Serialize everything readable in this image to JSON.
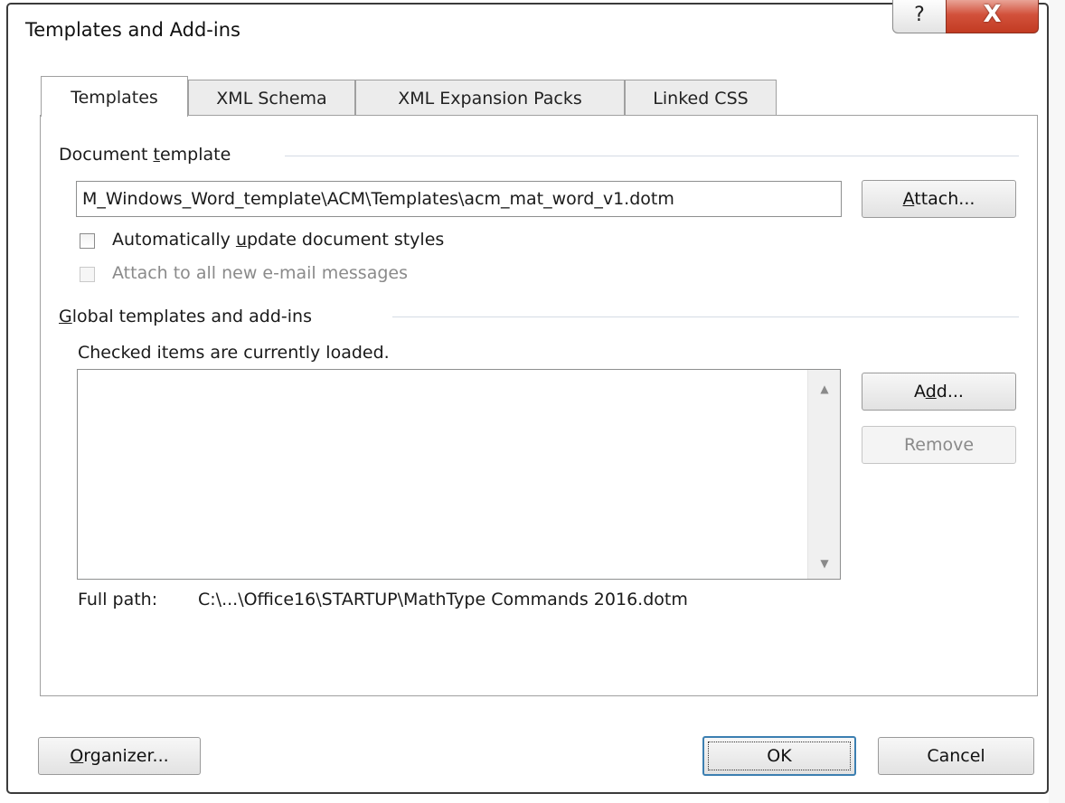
{
  "window": {
    "title": "Templates and Add-ins",
    "help_glyph": "?",
    "close_glyph": "X"
  },
  "tabs": [
    {
      "label": "Templates",
      "active": true
    },
    {
      "label": "XML Schema",
      "active": false
    },
    {
      "label": "XML Expansion Packs",
      "active": false
    },
    {
      "label": "Linked CSS",
      "active": false
    }
  ],
  "document_template": {
    "section_pre": "Document ",
    "section_accel": "t",
    "section_post": "emplate",
    "path_value": "M_Windows_Word_template\\ACM\\Templates\\acm_mat_word_v1.dotm",
    "attach_accel": "A",
    "attach_rest": "ttach...",
    "auto_update": {
      "pre": "Automatically ",
      "accel": "u",
      "post": "pdate document styles",
      "checked": false,
      "enabled": true
    },
    "attach_all": {
      "label": "Attach to all new e-mail messages",
      "checked": false,
      "enabled": false
    }
  },
  "global_templates": {
    "section_accel": "G",
    "section_rest": "lobal templates and add-ins",
    "hint": "Checked items are currently loaded.",
    "items": [],
    "add_pre": "A",
    "add_accel": "d",
    "add_post": "d...",
    "remove_label": "Remove",
    "remove_enabled": false,
    "full_path_label": "Full path:",
    "full_path_value": "C:\\...\\Office16\\STARTUP\\MathType Commands 2016.dotm"
  },
  "footer": {
    "organizer_accel": "O",
    "organizer_rest": "rganizer...",
    "ok_label": "OK",
    "cancel_label": "Cancel"
  },
  "icons": {
    "scroll_up": "▲",
    "scroll_down": "▼"
  },
  "colors": {
    "close_button": "#c23b22",
    "default_button_border": "#3c7fb1",
    "separator": "#d5dbe5"
  }
}
